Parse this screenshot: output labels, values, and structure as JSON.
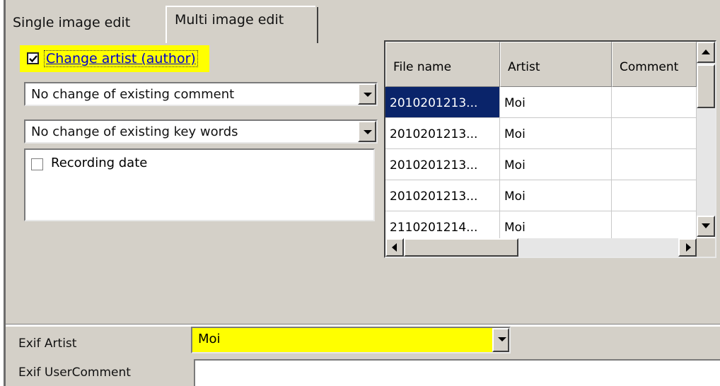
{
  "tabs": {
    "single_label": "Single image edit",
    "multi_label": "Multi image edit"
  },
  "artist_check": {
    "label": "Change artist (author)",
    "checked": true,
    "highlight_color": "#ffff00"
  },
  "comment_combo": {
    "value": "No change of existing comment"
  },
  "keywords_combo": {
    "value": "No change of existing key words"
  },
  "recording_date": {
    "label": "Recording date",
    "checked": false
  },
  "grid": {
    "columns": [
      "File name",
      "Artist",
      "Comment"
    ],
    "rows": [
      {
        "file": "2010201213...",
        "artist": "Moi",
        "comment": "",
        "selected": true
      },
      {
        "file": "2010201213...",
        "artist": "Moi",
        "comment": ""
      },
      {
        "file": "2010201213...",
        "artist": "Moi",
        "comment": ""
      },
      {
        "file": "2010201213...",
        "artist": "Moi",
        "comment": ""
      },
      {
        "file": "2110201214...",
        "artist": "Moi",
        "comment": ""
      }
    ],
    "selection_color": "#0a246a"
  },
  "exif": {
    "artist_label": "Exif Artist",
    "artist_value": "Moi",
    "comment_label": "Exif UserComment",
    "comment_value": ""
  },
  "icons": [
    "checkbox-checked-icon",
    "checkbox-empty-icon",
    "dropdown-arrow-icon",
    "scroll-up-icon",
    "scroll-down-icon",
    "scroll-left-icon",
    "scroll-right-icon"
  ]
}
